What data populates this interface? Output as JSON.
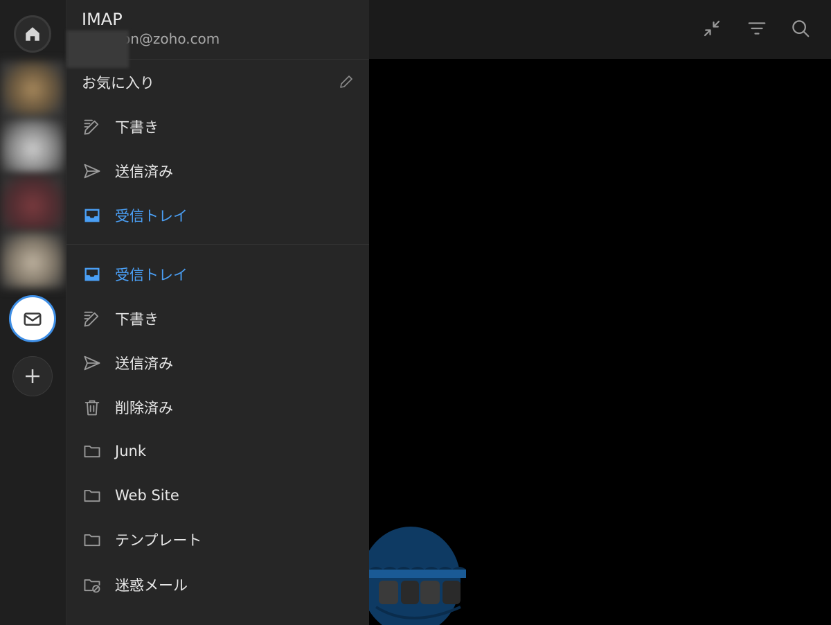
{
  "colors": {
    "accent": "#4a9ff5",
    "drawer_bg": "#262626",
    "rail_bg": "#1f1f1f",
    "content_bg": "#000000"
  },
  "account": {
    "type": "IMAP",
    "email": "on@zoho.com"
  },
  "favorites": {
    "header": "お気に入り",
    "items": [
      {
        "label": "下書き",
        "icon": "draft-pencil-icon",
        "active": false
      },
      {
        "label": "送信済み",
        "icon": "send-icon",
        "active": false
      },
      {
        "label": "受信トレイ",
        "icon": "inbox-icon",
        "active": true
      }
    ]
  },
  "folders": [
    {
      "label": "受信トレイ",
      "icon": "inbox-icon",
      "active": true
    },
    {
      "label": "下書き",
      "icon": "draft-pencil-icon",
      "active": false
    },
    {
      "label": "送信済み",
      "icon": "send-icon",
      "active": false
    },
    {
      "label": "削除済み",
      "icon": "trash-icon",
      "active": false
    },
    {
      "label": "Junk",
      "icon": "folder-icon",
      "active": false
    },
    {
      "label": "Web Site",
      "icon": "folder-icon",
      "active": false
    },
    {
      "label": "テンプレート",
      "icon": "folder-icon",
      "active": false
    },
    {
      "label": "迷惑メール",
      "icon": "folder-blocked-icon",
      "active": false
    }
  ],
  "toolbar_icons": [
    "collapse-icon",
    "filter-icon",
    "search-icon"
  ],
  "rail_icons": [
    "home-icon",
    "mail-icon",
    "add-icon"
  ]
}
